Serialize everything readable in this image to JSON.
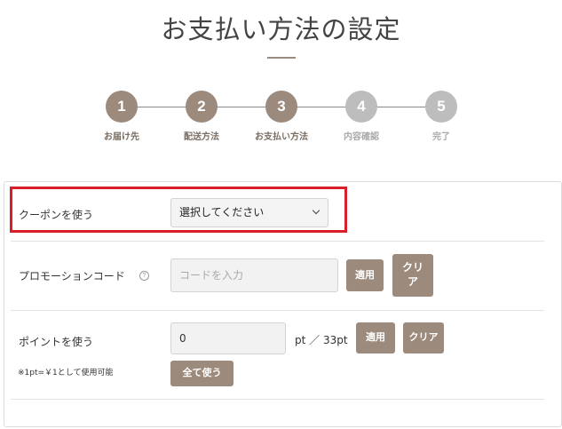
{
  "page": {
    "title": "お支払い方法の設定"
  },
  "steps": [
    {
      "number": "1",
      "label": "お届け先",
      "state": "done"
    },
    {
      "number": "2",
      "label": "配送方法",
      "state": "done"
    },
    {
      "number": "3",
      "label": "お支払い方法",
      "state": "current"
    },
    {
      "number": "4",
      "label": "内容確認",
      "state": "pending"
    },
    {
      "number": "5",
      "label": "完了",
      "state": "pending"
    }
  ],
  "colors": {
    "step_active": "#9c8a7c",
    "step_inactive": "#bdbdbd",
    "button": "#9c8a7c",
    "highlight": "#d9202a"
  },
  "coupon": {
    "label": "クーポンを使う",
    "selected": "選択してください"
  },
  "promo": {
    "label": "プロモーションコード",
    "help_icon": "?",
    "placeholder": "コードを入力",
    "apply": "適用",
    "clear": "クリ\nア"
  },
  "points": {
    "label": "ポイントを使う",
    "value": "0",
    "available_text": "pt ／ 33pt",
    "apply": "適用",
    "clear": "クリア",
    "use_all": "全て使う",
    "note": "※1pt=￥1として使用可能"
  }
}
